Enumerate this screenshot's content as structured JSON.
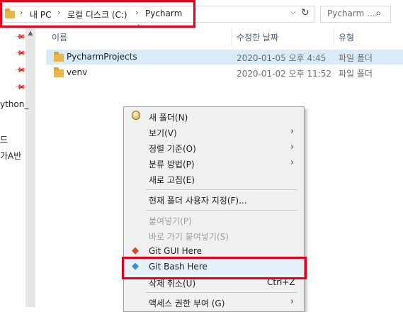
{
  "address": {
    "crumbs": [
      "내 PC",
      "로컬 디스크 (C:)",
      "Pycharm"
    ],
    "search_placeholder": "Pycharm ..."
  },
  "nav": {
    "items": [
      "ython_",
      "드",
      "가A반"
    ]
  },
  "file_list": {
    "columns": {
      "name": "이름",
      "date": "수정한 날짜",
      "type": "유형"
    },
    "rows": [
      {
        "name": "PycharmProjects",
        "date": "2020-01-05 오후 4:45",
        "type": "파일 폴더"
      },
      {
        "name": "venv",
        "date": "2020-01-02 오후 11:52",
        "type": "파일 폴더"
      }
    ]
  },
  "context_menu": {
    "new_folder": "새 폴더(N)",
    "view": "보기(V)",
    "sort_by": "정렬 기준(O)",
    "group_by": "분류 방법(P)",
    "refresh": "새로 고침(E)",
    "customize": "현재 폴더 사용자 지정(F)...",
    "paste": "붙여넣기(P)",
    "paste_shortcut": "바로 가기 붙여넣기(S)",
    "git_gui": "Git GUI Here",
    "git_bash": "Git Bash Here",
    "undo_delete": "삭제 취소(U)",
    "undo_shortcut": "Ctrl+Z",
    "access": "액세스 권한 부여 (G)"
  },
  "colors": {
    "highlight": "#e0001b",
    "folder": "#e8b74a",
    "selection": "#d9ebf9"
  }
}
